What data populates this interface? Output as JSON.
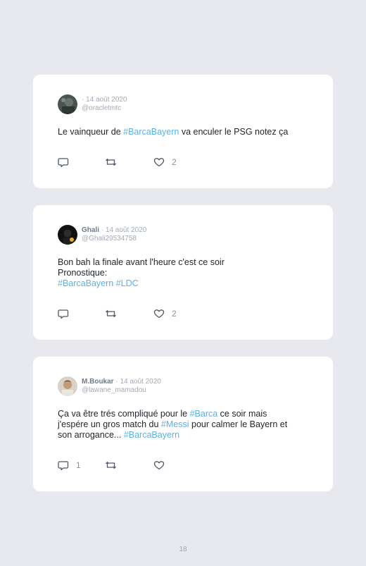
{
  "tweets": [
    {
      "name": "",
      "date": "· 14 août 2020",
      "handle": "@oracletmtc",
      "text_parts": [
        "Le vainqueur de ",
        "#BarcaBayern",
        " va enculer le PSG notez ça"
      ],
      "replies": "",
      "likes": "2"
    },
    {
      "name": "Ghali",
      "date": "· 14 août 2020",
      "handle": "@Ghali29534758",
      "line1": "Bon bah la finale avant l'heure c'est ce soir",
      "line2": "Pronostique:",
      "tag1": "#BarcaBayern",
      "tag2": "#LDC",
      "replies": "",
      "likes": "2"
    },
    {
      "name": "M.Boukar",
      "date": "· 14 août 2020",
      "handle": "@lawane_mamadou",
      "p1": "Ça va être trés compliqué pour le ",
      "tag1": "#Barca",
      "p2": " ce soir mais",
      "p3": "j'espére un gros match du ",
      "tag2": "#Messi",
      "p4": " pour calmer le Bayern et",
      "p5": "son arrogance... ",
      "tag3": "#BarcaBayern",
      "replies": "1",
      "likes": ""
    }
  ],
  "page_number": "18",
  "colors": {
    "background": "#e7e9ee",
    "card": "#ffffff",
    "hashtag": "#5ab0e6",
    "muted": "#a2aab6"
  }
}
